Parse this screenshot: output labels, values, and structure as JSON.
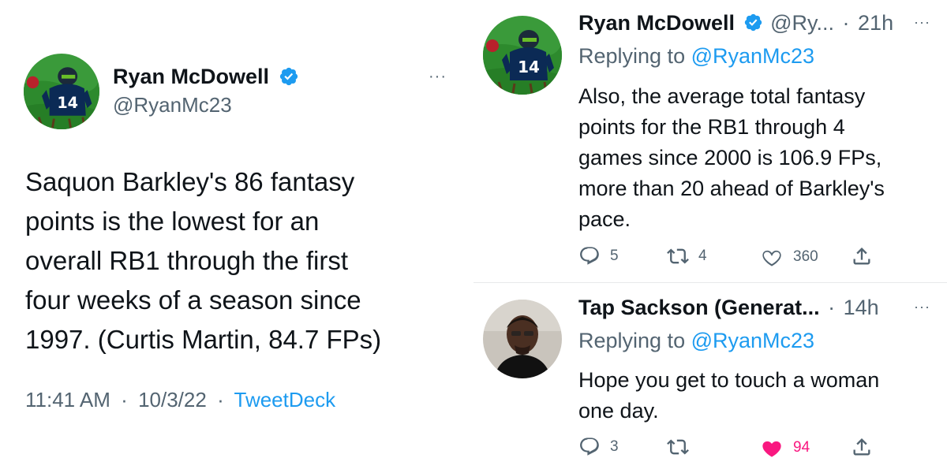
{
  "left_tweet": {
    "author_name": "Ryan McDowell",
    "author_handle": "@RyanMc23",
    "text_lines": [
      "Saquon Barkley's 86 fantasy",
      "points is the lowest for an",
      "overall RB1 through the first",
      "four weeks of a season since",
      "1997. (Curtis Martin, 84.7 FPs)"
    ],
    "time": "11:41 AM",
    "separator": "·",
    "date": "10/3/22",
    "source": "TweetDeck",
    "more": "···"
  },
  "reply_one": {
    "author_name": "Ryan McDowell",
    "author_handle": "@Ry...",
    "separator": "·",
    "time_ago": "21h",
    "replying_prefix": "Replying to ",
    "replying_handle": "@RyanMc23",
    "text_lines": [
      "Also, the average total fantasy",
      "points for the RB1 through 4",
      "games since 2000 is 106.9 FPs,",
      "more than 20 ahead of Barkley's",
      "pace."
    ],
    "replies": "5",
    "retweets": "4",
    "likes": "360",
    "more": "···"
  },
  "reply_two": {
    "author_name": "Tap Sackson (Generat...",
    "separator": "·",
    "time_ago": "14h",
    "replying_prefix": "Replying to ",
    "replying_handle": "@RyanMc23",
    "text_lines": [
      "Hope you get to touch a woman",
      "one day."
    ],
    "replies": "3",
    "retweets": "",
    "likes": "94",
    "liked": true,
    "more": "···"
  },
  "colors": {
    "text": "#0f1419",
    "muted": "#536471",
    "link": "#1d9bf0",
    "liked": "#f91880",
    "avatar_green": "#2f8f2f"
  },
  "icons": {
    "verified": "verified-badge-icon",
    "reply": "reply-icon",
    "retweet": "retweet-icon",
    "like": "heart-icon",
    "share": "share-icon"
  }
}
